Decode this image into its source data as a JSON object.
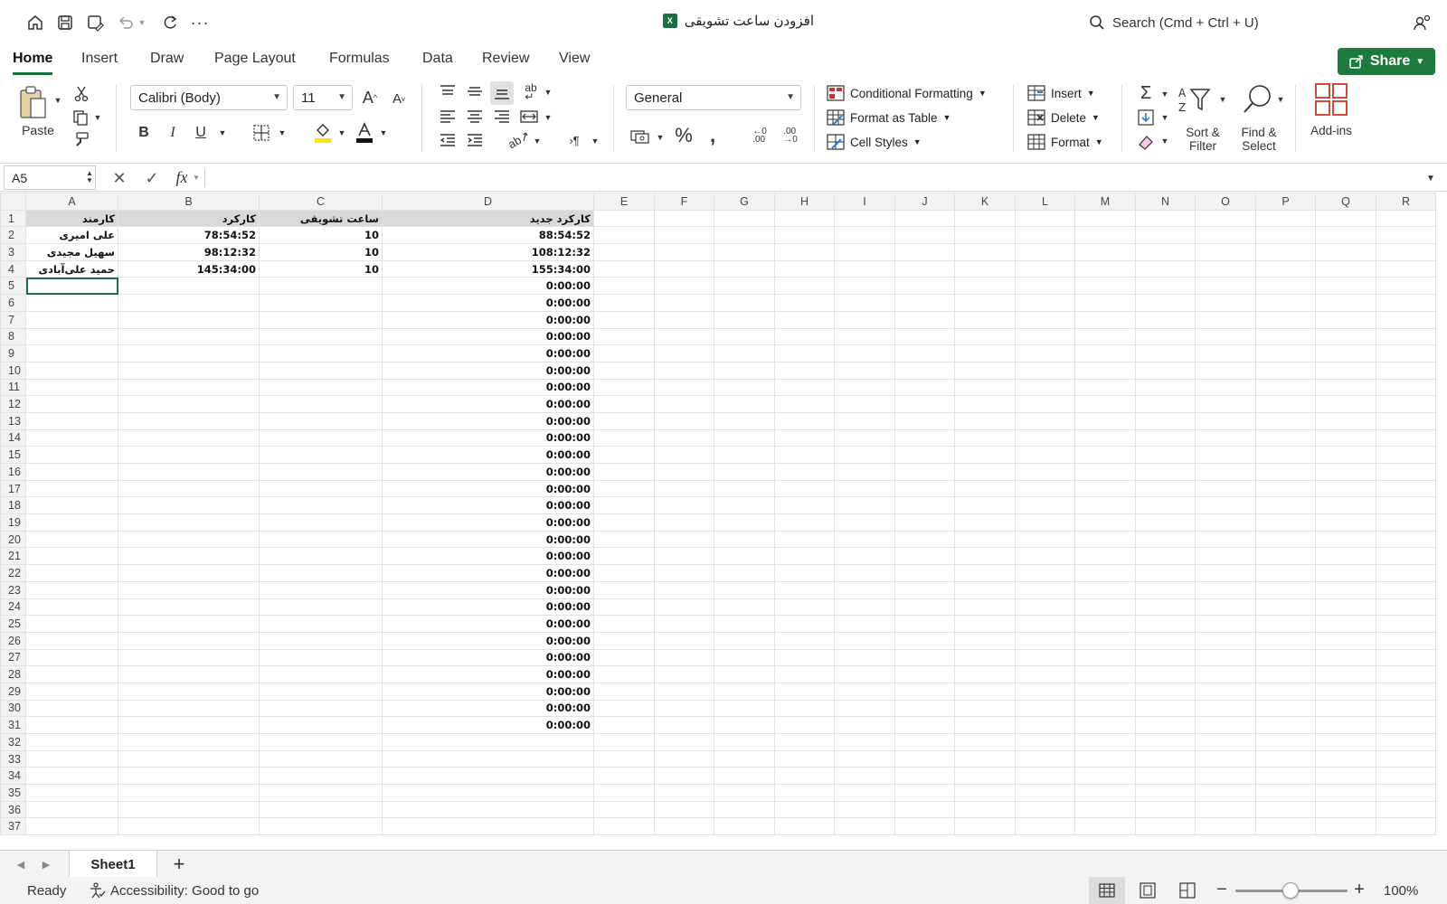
{
  "title_bar": {
    "document_title": "افزودن ساعت تشویقی",
    "search_placeholder": "Search (Cmd + Ctrl + U)"
  },
  "menu": {
    "tabs": [
      "Home",
      "Insert",
      "Draw",
      "Page Layout",
      "Formulas",
      "Data",
      "Review",
      "View"
    ],
    "active_tab": "Home",
    "share_label": "Share"
  },
  "ribbon": {
    "paste_label": "Paste",
    "font_name": "Calibri (Body)",
    "font_size": "11",
    "number_format": "General",
    "conditional_formatting": "Conditional Formatting",
    "format_as_table": "Format as Table",
    "cell_styles": "Cell Styles",
    "insert": "Insert",
    "delete": "Delete",
    "format": "Format",
    "sort_filter": "Sort & Filter",
    "find_select": "Find & Select",
    "add_ins": "Add-ins"
  },
  "formula_bar": {
    "name_box": "A5",
    "fx_label": "fx",
    "formula": ""
  },
  "sheet": {
    "columns": [
      "A",
      "B",
      "C",
      "D",
      "E",
      "F",
      "G",
      "H",
      "I",
      "J",
      "K",
      "L",
      "M",
      "N",
      "O",
      "P",
      "Q",
      "R"
    ],
    "header_row": [
      "کارمند",
      "کارکرد",
      "ساعت تشویقی",
      "کارکرد جدید"
    ],
    "rows": [
      [
        "علی امیری",
        "78:54:52",
        "10",
        "88:54:52"
      ],
      [
        "سهیل مجیدی",
        "98:12:32",
        "10",
        "108:12:32"
      ],
      [
        "حمید علی‌آبادی",
        "145:34:00",
        "10",
        "155:34:00"
      ]
    ],
    "d_column_fill_value": "0:00:00",
    "d_column_fill_rows": 27,
    "total_rows": 37,
    "selected_cell": "A5"
  },
  "sheet_tabs": {
    "tabs": [
      "Sheet1"
    ],
    "add_label": "+"
  },
  "status_bar": {
    "ready": "Ready",
    "accessibility": "Accessibility: Good to go",
    "zoom": "100%"
  },
  "colors": {
    "accent": "#1d6f42",
    "share_button": "#1f7a3d",
    "header_fill": "#d9d9d9"
  }
}
